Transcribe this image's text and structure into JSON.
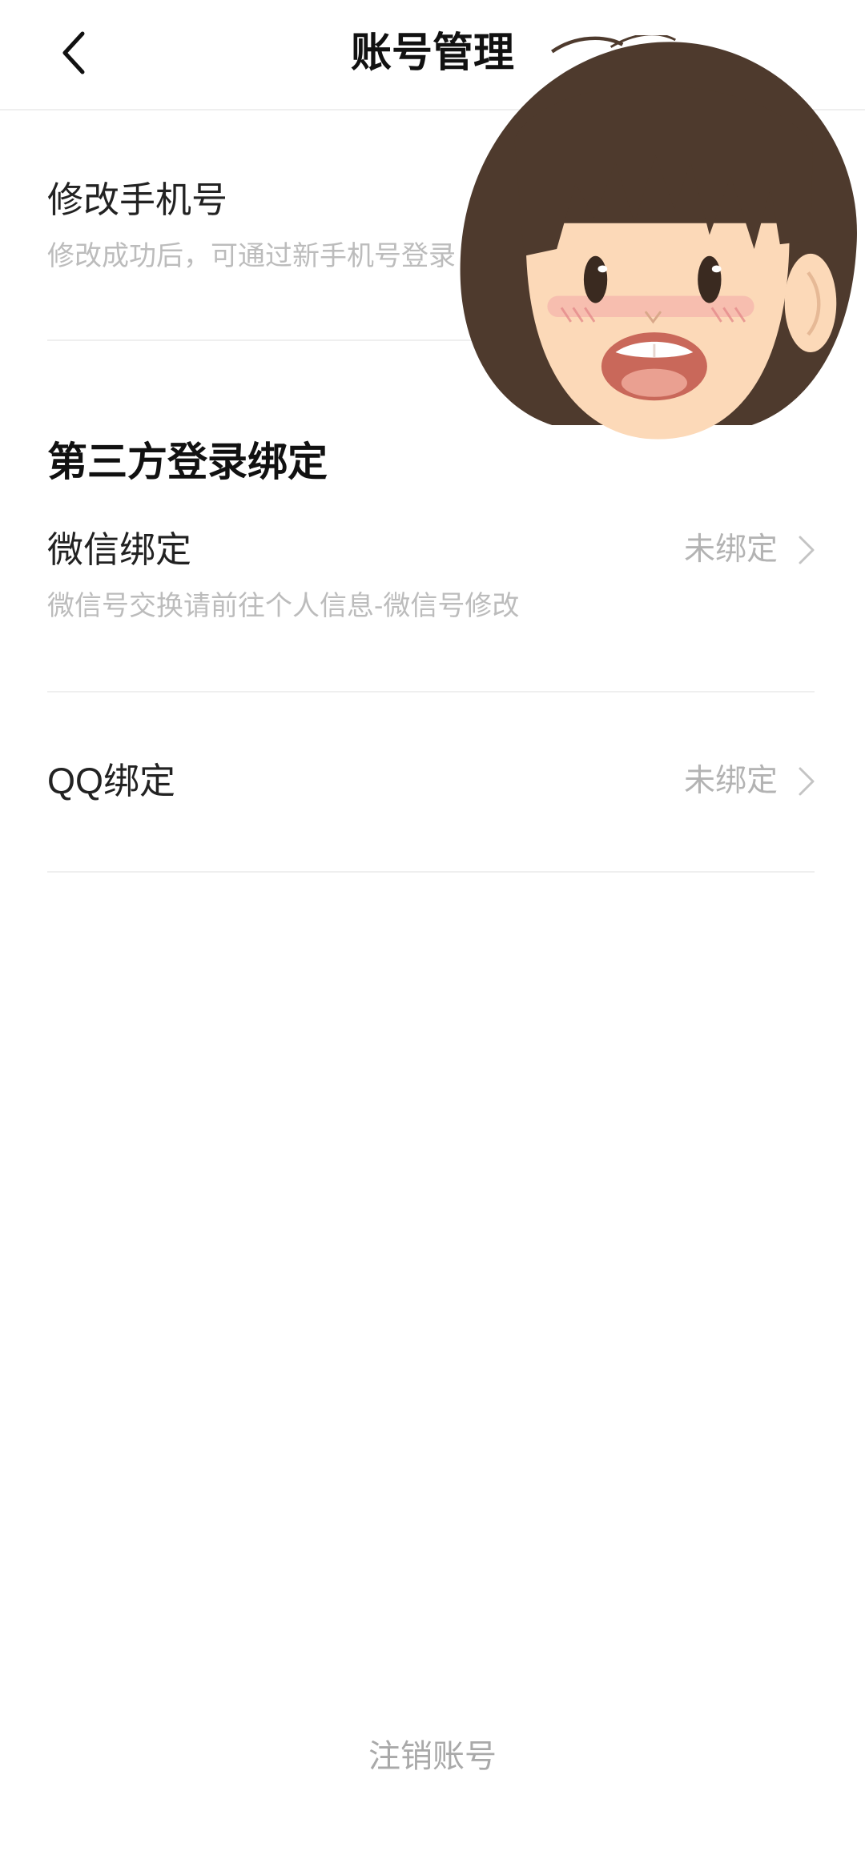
{
  "header": {
    "title": "账号管理",
    "back_icon": "chevron-left-icon"
  },
  "phone": {
    "title": "修改手机号",
    "subtitle": "修改成功后，可通过新手机号登录"
  },
  "third_party": {
    "section_title": "第三方登录绑定",
    "items": [
      {
        "label": "微信绑定",
        "status": "未绑定",
        "subtitle": "微信号交换请前往个人信息-微信号修改",
        "icon": "chevron-right-icon"
      },
      {
        "label": "QQ绑定",
        "status": "未绑定",
        "icon": "chevron-right-icon"
      }
    ]
  },
  "footer": {
    "cancel_account": "注销账号"
  },
  "sticker": {
    "icon": "cartoon-girl-face-sticker"
  },
  "colors": {
    "background": "#ffffff",
    "title_text": "#111111",
    "row_text": "#222222",
    "secondary_text": "#bcbcbc",
    "status_text": "#b3b3b3",
    "divider": "#efefef",
    "footer_text": "#a9a9a9"
  }
}
